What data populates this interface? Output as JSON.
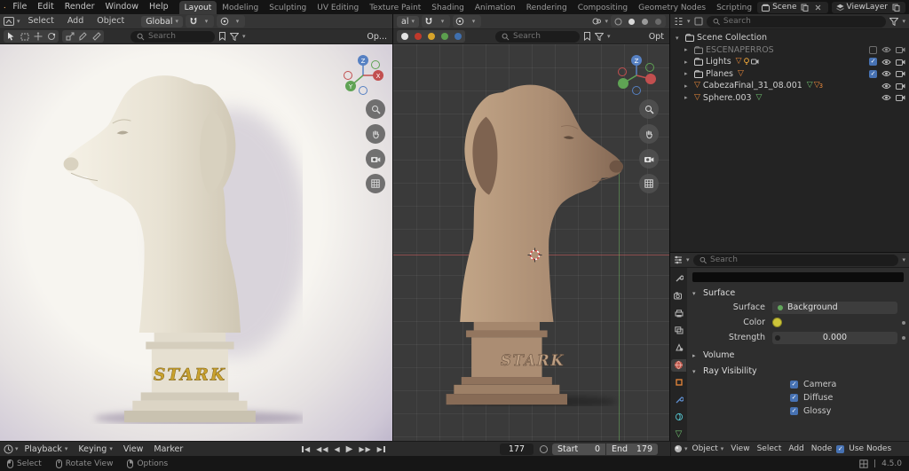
{
  "topbar": {
    "menus": [
      "File",
      "Edit",
      "Render",
      "Window",
      "Help"
    ],
    "tabs": [
      "Layout",
      "Modeling",
      "Sculpting",
      "UV Editing",
      "Texture Paint",
      "Shading",
      "Animation",
      "Rendering",
      "Compositing",
      "Geometry Nodes",
      "Scripting"
    ],
    "active_tab": "Layout",
    "scene": "Scene",
    "viewlayer": "ViewLayer"
  },
  "viewportA": {
    "menus": [
      "Select",
      "Add",
      "Object"
    ],
    "orientation": "Global",
    "search_placeholder": "Search",
    "options": "Op..."
  },
  "viewportB": {
    "orientation_partial": "al",
    "search_placeholder": "Search",
    "options": "Opt"
  },
  "scene3d": {
    "bust_text": "STARK"
  },
  "gizmo": {
    "x": "X",
    "y": "Y",
    "z": "Z"
  },
  "outliner": {
    "search_placeholder": "Search",
    "rows": [
      {
        "label": "Scene Collection"
      },
      {
        "label": "ESCENAPERROS"
      },
      {
        "label": "Lights"
      },
      {
        "label": "Planes"
      },
      {
        "label": "CabezaFinal_31_08.001",
        "badge": "3"
      },
      {
        "label": "Sphere.003"
      }
    ]
  },
  "properties": {
    "search_placeholder": "Search",
    "surface": {
      "section": "Surface",
      "label": "Surface",
      "value": "Background",
      "color_label": "Color",
      "strength_label": "Strength",
      "strength_value": "0.000"
    },
    "volume": {
      "section": "Volume"
    },
    "ray": {
      "section": "Ray Visibility",
      "items": [
        "Camera",
        "Diffuse",
        "Glossy"
      ]
    }
  },
  "timeline": {
    "menus": [
      "Playback",
      "Keying",
      "View",
      "Marker"
    ],
    "current_frame": "177",
    "start_label": "Start",
    "start_value": "0",
    "end_label": "End",
    "end_value": "179"
  },
  "shader": {
    "mode": "Object",
    "menus": [
      "View",
      "Select",
      "Add",
      "Node"
    ],
    "use_nodes": "Use Nodes"
  },
  "statusbar": {
    "items": [
      "Select",
      "Rotate View",
      "Options"
    ],
    "version": "4.5.0"
  },
  "glyphs": {
    "caret": "▾",
    "collapsed": "▸",
    "expanded": "▾",
    "check": "✓",
    "play": "▶",
    "rev": "◀",
    "tri": "▽"
  },
  "colors": {
    "accent": "#4772b3",
    "mesh_orange": "#e8883a",
    "gold": "#c9a22e",
    "marble": "#ece7db",
    "clay": "#b0937a"
  }
}
